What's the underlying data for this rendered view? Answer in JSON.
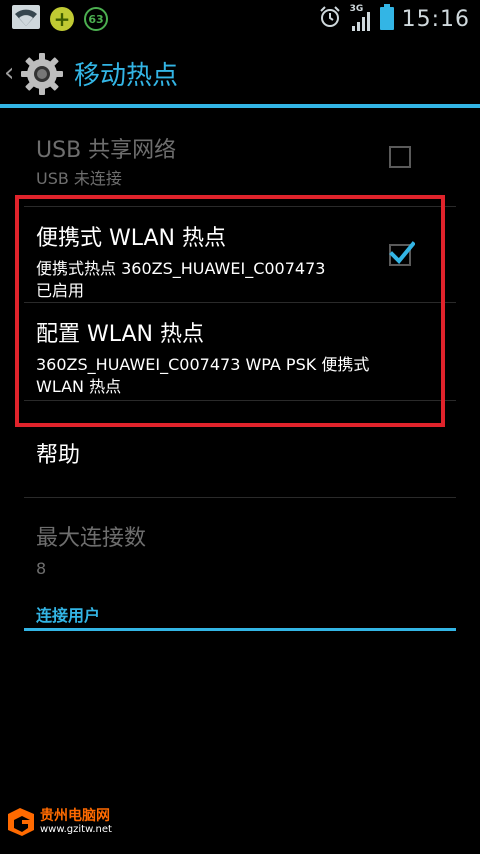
{
  "statusbar": {
    "notification_badge": "63",
    "network_type": "3G",
    "time": "15:16",
    "icons": [
      "wifi-icon",
      "plus-icon",
      "badge-63-icon",
      "alarm-icon",
      "signal-icon",
      "battery-icon"
    ]
  },
  "actionbar": {
    "title": "移动热点",
    "accent_color": "#33b5e5"
  },
  "settings": {
    "usb": {
      "title": "USB 共享网络",
      "summary": "USB 未连接",
      "checked": false,
      "enabled": false
    },
    "wlan_hotspot": {
      "title": "便携式 WLAN 热点",
      "summary_line1": "便携式热点 360ZS_HUAWEI_C007473",
      "summary_line2": "已启用",
      "checked": true
    },
    "configure": {
      "title": "配置 WLAN 热点",
      "summary_line1": "360ZS_HUAWEI_C007473 WPA PSK 便携式",
      "summary_line2": "WLAN 热点"
    },
    "help": {
      "title": "帮助"
    },
    "max_connections": {
      "title": "最大连接数",
      "value": "8",
      "enabled": false
    },
    "connected_users_header": "连接用户"
  },
  "highlight_color": "#e0232b",
  "watermark": {
    "line1": "贵州电脑网",
    "line2": "www.gzitw.net"
  }
}
